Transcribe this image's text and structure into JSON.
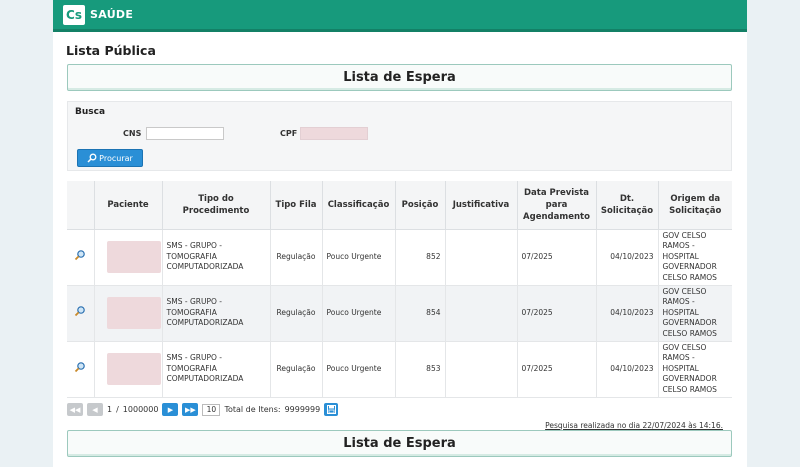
{
  "header": {
    "logo_mark": "Cs",
    "logo_text": "SAÚDE"
  },
  "page_title": "Lista Pública",
  "section_title": "Lista de Espera",
  "search": {
    "title": "Busca",
    "cns_label": "CNS",
    "cns_value": "",
    "cpf_label": "CPF",
    "button_label": "Procurar"
  },
  "table": {
    "columns": [
      "",
      "Paciente",
      "Tipo do Procedimento",
      "Tipo Fila",
      "Classificação",
      "Posição",
      "Justificativa",
      "Data Prevista para Agendamento",
      "Dt. Solicitação",
      "Origem da Solicitação"
    ],
    "rows": [
      {
        "procedimento": "SMS - GRUPO - TOMOGRAFIA COMPUTADORIZADA",
        "tipo_fila": "Regulação",
        "classificacao": "Pouco Urgente",
        "posicao": "852",
        "justificativa": "",
        "data_prevista": "07/2025",
        "dt_solicitacao": "04/10/2023",
        "origem": "GOV CELSO RAMOS - HOSPITAL GOVERNADOR CELSO RAMOS"
      },
      {
        "procedimento": "SMS - GRUPO - TOMOGRAFIA COMPUTADORIZADA",
        "tipo_fila": "Regulação",
        "classificacao": "Pouco Urgente",
        "posicao": "854",
        "justificativa": "",
        "data_prevista": "07/2025",
        "dt_solicitacao": "04/10/2023",
        "origem": "GOV CELSO RAMOS - HOSPITAL GOVERNADOR CELSO RAMOS"
      },
      {
        "procedimento": "SMS - GRUPO - TOMOGRAFIA COMPUTADORIZADA",
        "tipo_fila": "Regulação",
        "classificacao": "Pouco Urgente",
        "posicao": "853",
        "justificativa": "",
        "data_prevista": "07/2025",
        "dt_solicitacao": "04/10/2023",
        "origem": "GOV CELSO RAMOS - HOSPITAL GOVERNADOR CELSO RAMOS"
      }
    ]
  },
  "pager": {
    "current_page": "1",
    "separator": "/",
    "total_pages": "1000000",
    "page_size": "10",
    "total_label": "Total de Itens:",
    "total_value": "9999999"
  },
  "footer_note": "Pesquisa realizada no dia 22/07/2024 às 14:16.",
  "colors": {
    "topbar": "#179a7c",
    "button": "#2a8fd6",
    "redacted": "#eed9dc"
  },
  "icons": [
    "magnifier-icon",
    "first-page-icon",
    "prev-page-icon",
    "next-page-icon",
    "last-page-icon",
    "save-icon"
  ]
}
